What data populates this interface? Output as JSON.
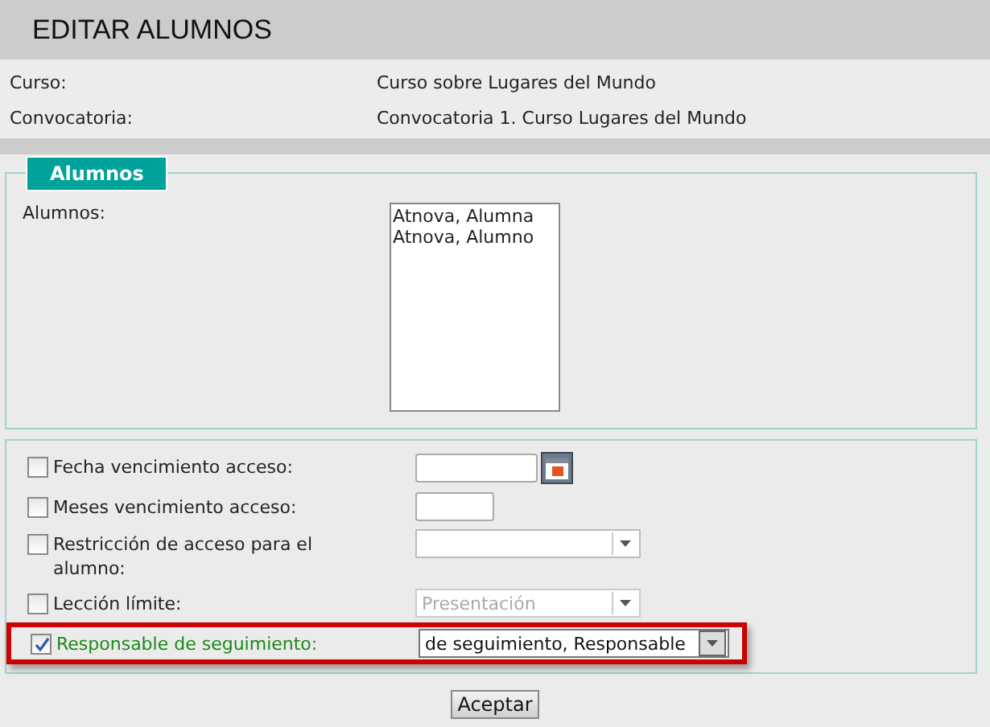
{
  "header": {
    "title": "EDITAR ALUMNOS"
  },
  "info": [
    {
      "label": "Curso:",
      "value": "Curso sobre Lugares del Mundo"
    },
    {
      "label": "Convocatoria:",
      "value": "Convocatoria 1. Curso Lugares del Mundo"
    }
  ],
  "students_panel": {
    "legend": "Alumnos",
    "label": "Alumnos:",
    "options": [
      "Atnova, Alumna",
      "Atnova, Alumno"
    ]
  },
  "options": [
    {
      "kind": "date",
      "label": "Fecha vencimiento acceso:",
      "checked": false,
      "highlighted": false
    },
    {
      "kind": "text",
      "label": "Meses vencimiento acceso:",
      "checked": false,
      "highlighted": false
    },
    {
      "kind": "select",
      "label": "Restricción de acceso para el alumno:",
      "checked": false,
      "highlighted": false,
      "disabled": false
    },
    {
      "kind": "select",
      "label": "Lección límite:",
      "checked": false,
      "highlighted": false,
      "disabled": true,
      "value": "Presentación"
    },
    {
      "kind": "select",
      "label": "Responsable de seguimiento:",
      "checked": true,
      "highlighted": true,
      "disabled": false,
      "value": "de seguimiento, Responsable"
    }
  ],
  "submit": {
    "label": "Aceptar"
  }
}
